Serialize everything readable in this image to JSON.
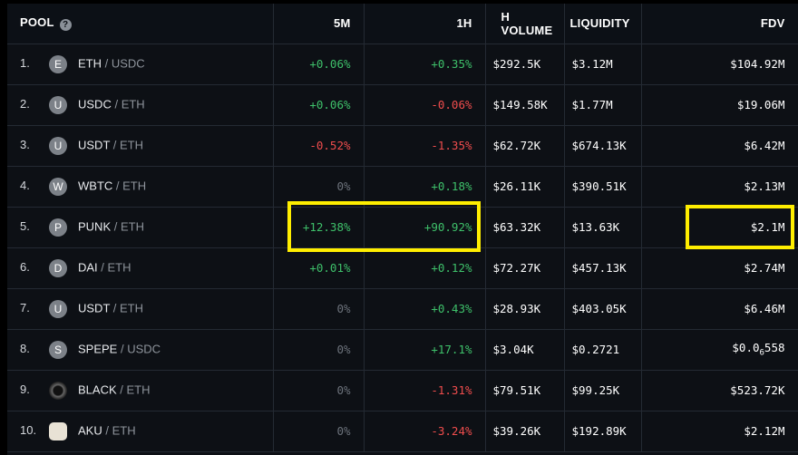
{
  "headers": {
    "pool": "POOL",
    "help_icon": "?",
    "m5": "5M",
    "h1": "1H",
    "volume": "H VOLUME",
    "volume_prefix": "·",
    "liquidity": "LIQUIDITY",
    "fdv": "FDV"
  },
  "rows": [
    {
      "idx": "1.",
      "icon": "E",
      "base": "ETH",
      "sep": " / ",
      "quote": "USDC",
      "m5": "+0.06%",
      "h1": "+0.35%",
      "volume": "$292.5K",
      "liquidity": "$3.12M",
      "fdv": "$104.92M"
    },
    {
      "idx": "2.",
      "icon": "U",
      "base": "USDC",
      "sep": " / ",
      "quote": "ETH",
      "m5": "+0.06%",
      "h1": "-0.06%",
      "volume": "$149.58K",
      "liquidity": "$1.77M",
      "fdv": "$19.06M"
    },
    {
      "idx": "3.",
      "icon": "U",
      "base": "USDT",
      "sep": " / ",
      "quote": "ETH",
      "m5": "-0.52%",
      "h1": "-1.35%",
      "volume": "$62.72K",
      "liquidity": "$674.13K",
      "fdv": "$6.42M"
    },
    {
      "idx": "4.",
      "icon": "W",
      "base": "WBTC",
      "sep": " / ",
      "quote": "ETH",
      "m5": "0%",
      "h1": "+0.18%",
      "volume": "$26.11K",
      "liquidity": "$390.51K",
      "fdv": "$2.13M"
    },
    {
      "idx": "5.",
      "icon": "P",
      "base": "PUNK",
      "sep": " / ",
      "quote": "ETH",
      "m5": "+12.38%",
      "h1": "+90.92%",
      "volume": "$63.32K",
      "liquidity": "$13.63K",
      "fdv": "$2.1M"
    },
    {
      "idx": "6.",
      "icon": "D",
      "base": "DAI",
      "sep": " / ",
      "quote": "ETH",
      "m5": "+0.01%",
      "h1": "+0.12%",
      "volume": "$72.27K",
      "liquidity": "$457.13K",
      "fdv": "$2.74M"
    },
    {
      "idx": "7.",
      "icon": "U",
      "base": "USDT",
      "sep": " / ",
      "quote": "ETH",
      "m5": "0%",
      "h1": "+0.43%",
      "volume": "$28.93K",
      "liquidity": "$403.05K",
      "fdv": "$6.46M"
    },
    {
      "idx": "8.",
      "icon": "S",
      "base": "SPEPE",
      "sep": " / ",
      "quote": "USDC",
      "m5": "0%",
      "h1": "+17.1%",
      "volume": "$3.04K",
      "liquidity": "$0.2721",
      "fdv_main": "$0.0",
      "fdv_sub": "6",
      "fdv_tail": "558"
    },
    {
      "idx": "9.",
      "icon": "",
      "base": "BLACK",
      "sep": " / ",
      "quote": "ETH",
      "m5": "0%",
      "h1": "-1.31%",
      "volume": "$79.51K",
      "liquidity": "$99.25K",
      "fdv": "$523.72K"
    },
    {
      "idx": "10.",
      "icon": "",
      "base": "AKU",
      "sep": " / ",
      "quote": "ETH",
      "m5": "0%",
      "h1": "-3.24%",
      "volume": "$39.26K",
      "liquidity": "$192.89K",
      "fdv": "$2.12M"
    }
  ],
  "colors": {
    "positive": "#3ec06a",
    "negative": "#f04d4d",
    "neutral": "#6c727b",
    "highlight": "#ffee00",
    "background": "#0d1015"
  }
}
